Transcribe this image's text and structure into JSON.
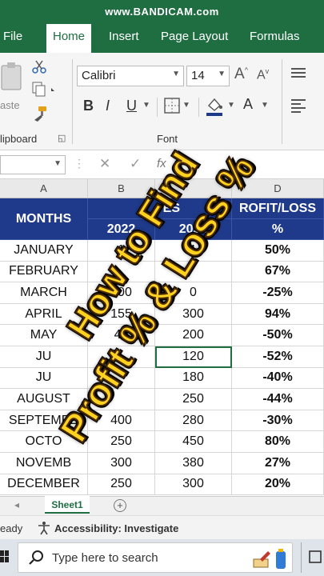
{
  "watermark": "www.BANDICAM.com",
  "ribbon": {
    "tabs": [
      {
        "label": "File",
        "active": false
      },
      {
        "label": "Home",
        "active": true
      },
      {
        "label": "Insert",
        "active": false
      },
      {
        "label": "Page Layout",
        "active": false
      },
      {
        "label": "Formulas",
        "active": false
      }
    ],
    "paste_label": "aste",
    "clipboard_label": "lipboard",
    "font_group_label": "Font",
    "font_name": "Calibri",
    "font_size": "14",
    "bold": "B",
    "italic": "I",
    "underline": "U",
    "grow_font": "A",
    "shrink_font": "A",
    "font_color": "A"
  },
  "formula_bar": {
    "cancel": "✕",
    "confirm": "✓",
    "fx": "fx"
  },
  "grid": {
    "col_headers": [
      "A",
      "B",
      "",
      "D"
    ],
    "header_row": {
      "months": "MONTHS",
      "group_fragment": "ES",
      "y2022": "2022",
      "y2023": "2023",
      "profit_loss_line1": "ROFIT/LOSS",
      "profit_loss_line2": "%"
    },
    "rows": [
      {
        "month": "JANUARY",
        "y2022": "1",
        "y2023": "1",
        "pct": "50%"
      },
      {
        "month": "FEBRUARY",
        "y2022": "",
        "y2023": "",
        "pct": "67%"
      },
      {
        "month": "MARCH",
        "y2022": "200",
        "y2023": "0",
        "pct": "-25%"
      },
      {
        "month": "APRIL",
        "y2022": "155",
        "y2023": "300",
        "pct": "94%"
      },
      {
        "month": "MAY",
        "y2022": "40",
        "y2023": "200",
        "pct": "-50%"
      },
      {
        "month": "JU",
        "y2022": "",
        "y2023": "120",
        "pct": "-52%"
      },
      {
        "month": "JU",
        "y2022": "",
        "y2023": "180",
        "pct": "-40%"
      },
      {
        "month": "AUGUST",
        "y2022": "",
        "y2023": "250",
        "pct": "-44%"
      },
      {
        "month": "SEPTEMBE",
        "y2022": "400",
        "y2023": "280",
        "pct": "-30%"
      },
      {
        "month": "OCTO",
        "y2022": "250",
        "y2023": "450",
        "pct": "80%"
      },
      {
        "month": "NOVEMB",
        "y2022": "300",
        "y2023": "380",
        "pct": "27%"
      },
      {
        "month": "DECEMBER",
        "y2022": "250",
        "y2023": "300",
        "pct": "20%"
      }
    ]
  },
  "sheets": {
    "active": "Sheet1",
    "add": "+"
  },
  "status": {
    "ready": "eady",
    "accessibility": "Accessibility: Investigate"
  },
  "taskbar": {
    "search_placeholder": "Type here to search"
  },
  "overlay": {
    "line1": "How to Find",
    "line2": "Profit % & Loss %"
  },
  "colors": {
    "excel_green": "#1e6e42",
    "header_blue": "#1f3a8a",
    "overlay_yellow": "#ffd21f"
  }
}
